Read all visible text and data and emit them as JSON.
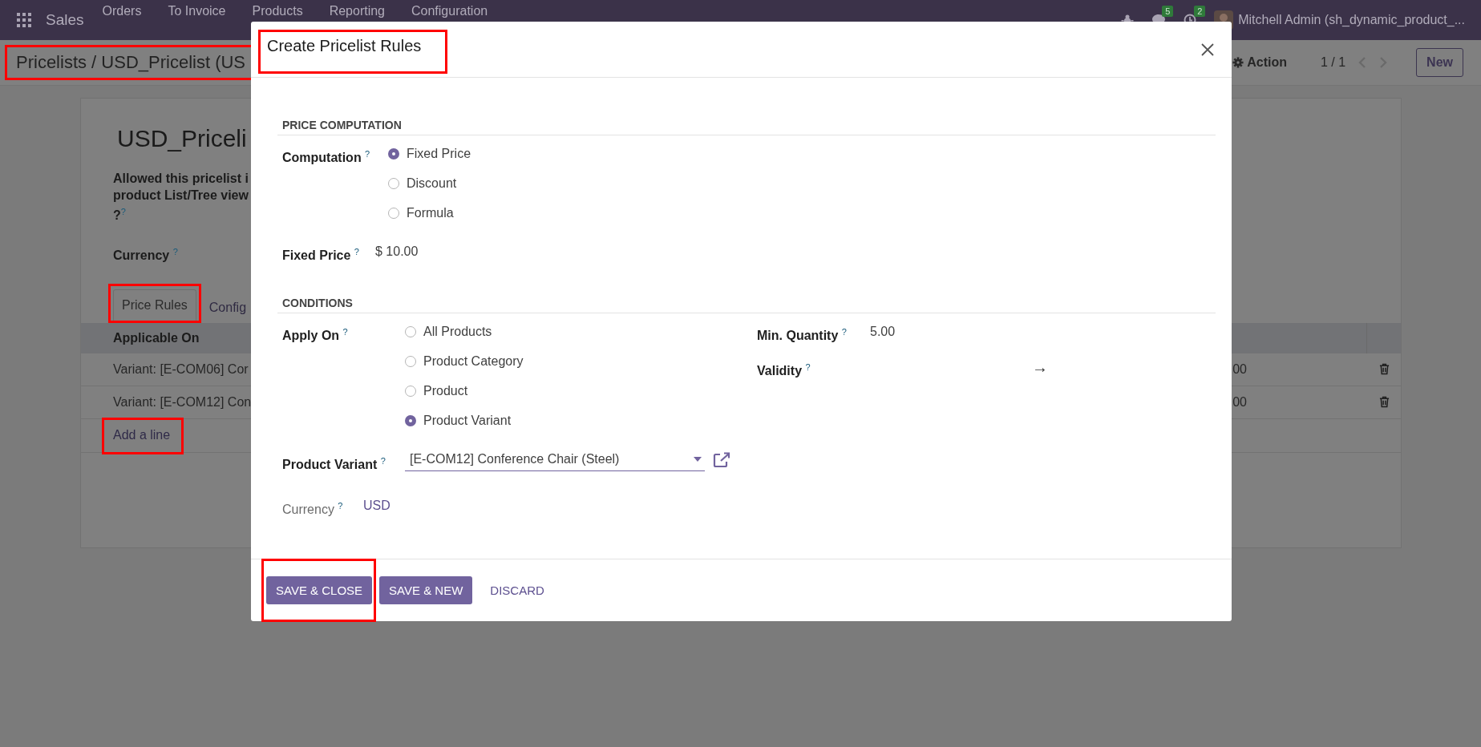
{
  "navbar": {
    "app": "Sales",
    "menu": [
      "Orders",
      "To Invoice",
      "Products",
      "Reporting",
      "Configuration"
    ],
    "messages_badge": "5",
    "activities_badge": "2",
    "user": "Mitchell Admin (sh_dynamic_product_..."
  },
  "control_panel": {
    "breadcrumb": {
      "text": "Pricelists / USD_Pricelist (US",
      "highlighted": true
    },
    "action": "Action",
    "pager": "1 / 1",
    "new_button": "New"
  },
  "sheet": {
    "title": "USD_Priceli",
    "allowed_label_lines": [
      "Allowed this pricelist i",
      "product List/Tree view",
      "?"
    ],
    "allowed_help": "?",
    "currency_label": "Currency",
    "currency_help": "?",
    "tabs": [
      {
        "label": "Price Rules",
        "selected": true,
        "highlighted": true
      },
      {
        "label": "Config",
        "selected": false,
        "highlighted": false
      }
    ],
    "table": {
      "columns": [
        "Applicable On"
      ],
      "rows": [
        {
          "applicable_on": "Variant: [E-COM06] Cor",
          "column_2": "00"
        },
        {
          "applicable_on": "Variant: [E-COM12] Con",
          "column_2": "00"
        }
      ],
      "add_line": {
        "text": "Add a line",
        "highlighted": true
      }
    }
  },
  "dialog": {
    "title": {
      "text": "Create Pricelist Rules",
      "highlighted": true
    },
    "price_computation": {
      "heading": "PRICE COMPUTATION",
      "computation": {
        "label": "Computation",
        "help": "?",
        "options": [
          {
            "label": "Fixed Price",
            "selected": true
          },
          {
            "label": "Discount",
            "selected": false
          },
          {
            "label": "Formula",
            "selected": false
          }
        ]
      },
      "fixed_price": {
        "label": "Fixed Price",
        "help": "?",
        "value": "$ 10.00"
      }
    },
    "conditions": {
      "heading": "CONDITIONS",
      "apply_on": {
        "label": "Apply On",
        "help": "?",
        "options": [
          {
            "label": "All Products",
            "selected": false
          },
          {
            "label": "Product Category",
            "selected": false
          },
          {
            "label": "Product",
            "selected": false
          },
          {
            "label": "Product Variant",
            "selected": true
          }
        ]
      },
      "product_variant": {
        "label": "Product Variant",
        "help": "?",
        "value": "[E-COM12] Conference Chair (Steel)"
      },
      "currency": {
        "label": "Currency",
        "help": "?",
        "value": "USD"
      },
      "min_quantity": {
        "label": "Min. Quantity",
        "help": "?",
        "value": "5.00"
      },
      "validity": {
        "label": "Validity",
        "help": "?",
        "separator": "→"
      }
    },
    "buttons": [
      {
        "label": "SAVE & CLOSE",
        "kind": "primary",
        "highlighted": true
      },
      {
        "label": "SAVE & NEW",
        "kind": "primary",
        "highlighted": false
      },
      {
        "label": "DISCARD",
        "kind": "link",
        "highlighted": false
      }
    ]
  }
}
